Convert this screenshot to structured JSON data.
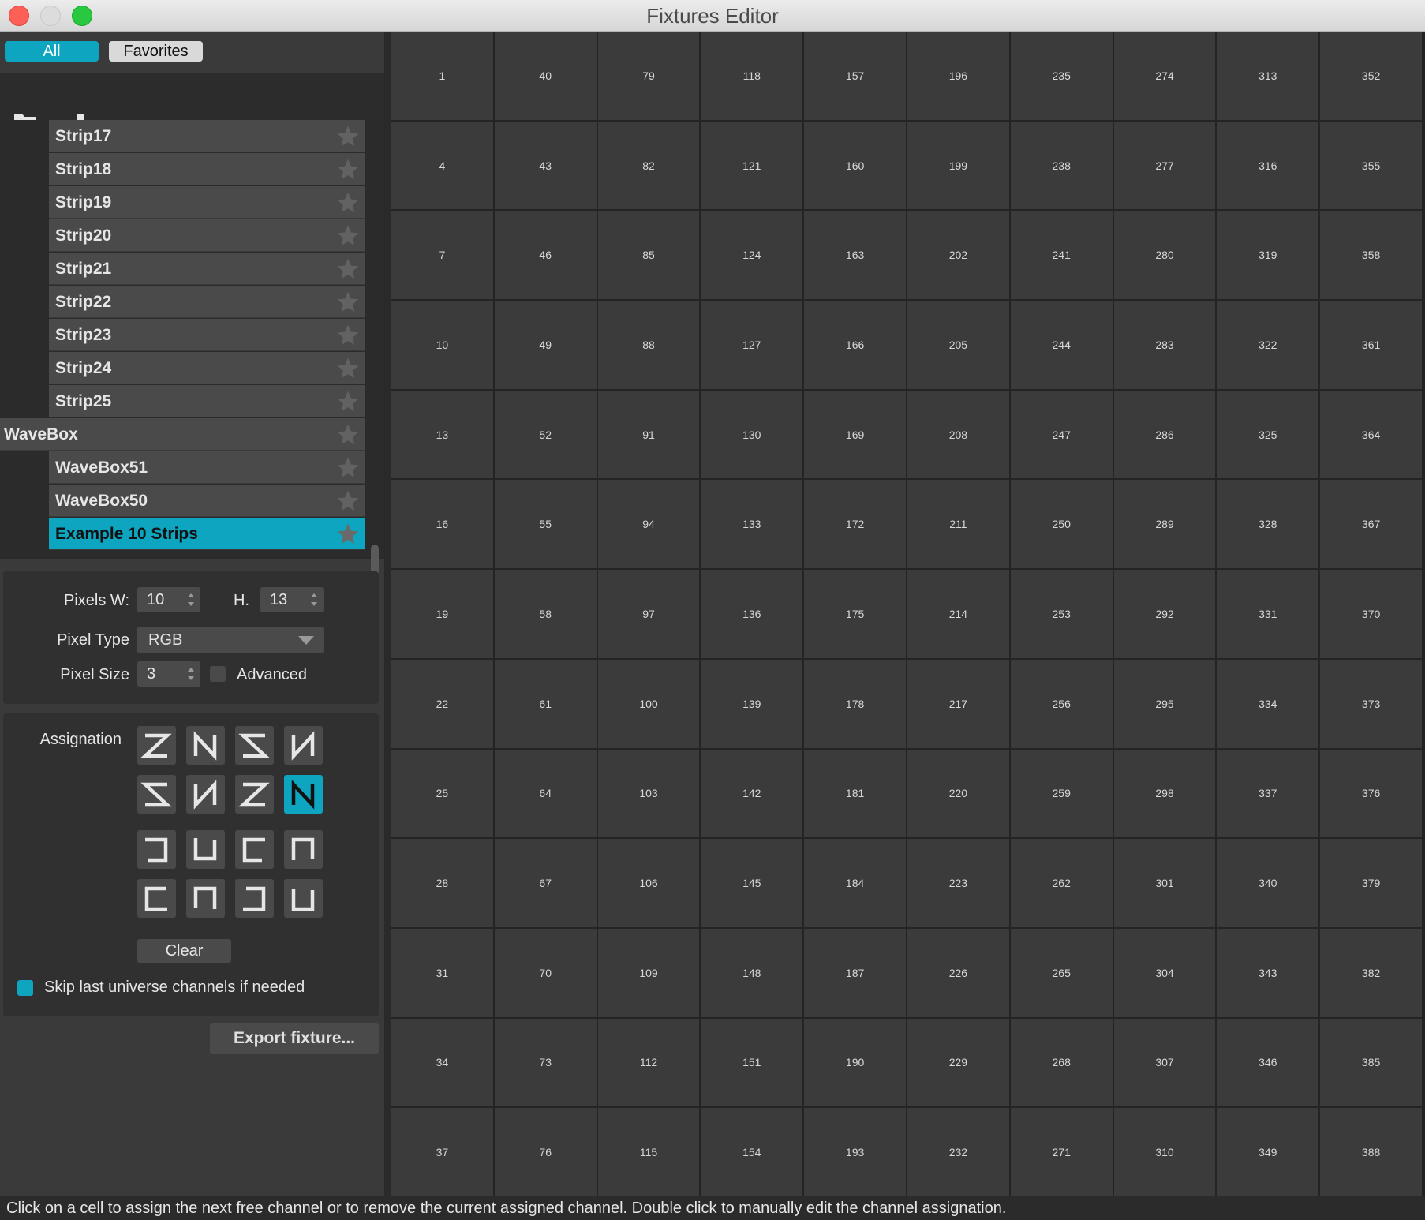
{
  "window": {
    "title": "Fixtures Editor"
  },
  "tabs": {
    "all": "All",
    "favorites": "Favorites"
  },
  "colors": {
    "accent": "#0ea5c0",
    "panel": "#3a3a3a",
    "cell": "#3b3b3b"
  },
  "toolbar": {
    "icons": [
      "add-folder-icon",
      "add-icon"
    ]
  },
  "fixtures": [
    {
      "label": "Strip17",
      "type": "child",
      "selected": false
    },
    {
      "label": "Strip18",
      "type": "child",
      "selected": false
    },
    {
      "label": "Strip19",
      "type": "child",
      "selected": false
    },
    {
      "label": "Strip20",
      "type": "child",
      "selected": false
    },
    {
      "label": "Strip21",
      "type": "child",
      "selected": false
    },
    {
      "label": "Strip22",
      "type": "child",
      "selected": false
    },
    {
      "label": "Strip23",
      "type": "child",
      "selected": false
    },
    {
      "label": "Strip24",
      "type": "child",
      "selected": false
    },
    {
      "label": "Strip25",
      "type": "child",
      "selected": false
    },
    {
      "label": "WaveBox",
      "type": "group",
      "selected": false
    },
    {
      "label": "WaveBox51",
      "type": "child",
      "selected": false
    },
    {
      "label": "WaveBox50",
      "type": "child",
      "selected": false
    },
    {
      "label": "Example 10 Strips",
      "type": "child",
      "selected": true
    }
  ],
  "settings": {
    "pixels_w_label": "Pixels W:",
    "pixels_w": "10",
    "h_label": "H.",
    "h": "13",
    "pixel_type_label": "Pixel Type",
    "pixel_type": "RGB",
    "pixel_size_label": "Pixel Size",
    "pixel_size": "3",
    "advanced_label": "Advanced",
    "advanced_checked": false
  },
  "assignation": {
    "label": "Assignation",
    "patterns": [
      "zigzag-z",
      "zigzag-n",
      "zigzag-z-reverse",
      "zigzag-n-reverse",
      "zigzag-s",
      "zigzag-n-up",
      "zigzag-s-reverse",
      "zigzag-n-selected",
      "snake-left-down",
      "snake-up",
      "snake-right-down",
      "snake-down",
      "snake-right",
      "snake-up-down",
      "snake-left",
      "snake-up-right"
    ],
    "selected_index": 7,
    "clear_label": "Clear",
    "skip_label": "Skip last universe channels if needed",
    "skip_checked": true
  },
  "export_label": "Export fixture...",
  "grid": {
    "columns": 10,
    "rows": [
      [
        "1",
        "40",
        "79",
        "118",
        "157",
        "196",
        "235",
        "274",
        "313",
        "352"
      ],
      [
        "4",
        "43",
        "82",
        "121",
        "160",
        "199",
        "238",
        "277",
        "316",
        "355"
      ],
      [
        "7",
        "46",
        "85",
        "124",
        "163",
        "202",
        "241",
        "280",
        "319",
        "358"
      ],
      [
        "10",
        "49",
        "88",
        "127",
        "166",
        "205",
        "244",
        "283",
        "322",
        "361"
      ],
      [
        "13",
        "52",
        "91",
        "130",
        "169",
        "208",
        "247",
        "286",
        "325",
        "364"
      ],
      [
        "16",
        "55",
        "94",
        "133",
        "172",
        "211",
        "250",
        "289",
        "328",
        "367"
      ],
      [
        "19",
        "58",
        "97",
        "136",
        "175",
        "214",
        "253",
        "292",
        "331",
        "370"
      ],
      [
        "22",
        "61",
        "100",
        "139",
        "178",
        "217",
        "256",
        "295",
        "334",
        "373"
      ],
      [
        "25",
        "64",
        "103",
        "142",
        "181",
        "220",
        "259",
        "298",
        "337",
        "376"
      ],
      [
        "28",
        "67",
        "106",
        "145",
        "184",
        "223",
        "262",
        "301",
        "340",
        "379"
      ],
      [
        "31",
        "70",
        "109",
        "148",
        "187",
        "226",
        "265",
        "304",
        "343",
        "382"
      ],
      [
        "34",
        "73",
        "112",
        "151",
        "190",
        "229",
        "268",
        "307",
        "346",
        "385"
      ],
      [
        "37",
        "76",
        "115",
        "154",
        "193",
        "232",
        "271",
        "310",
        "349",
        "388"
      ]
    ]
  },
  "status": "Click on a cell to assign the next free channel or to remove the current assigned channel. Double click to manually edit the channel assignation."
}
